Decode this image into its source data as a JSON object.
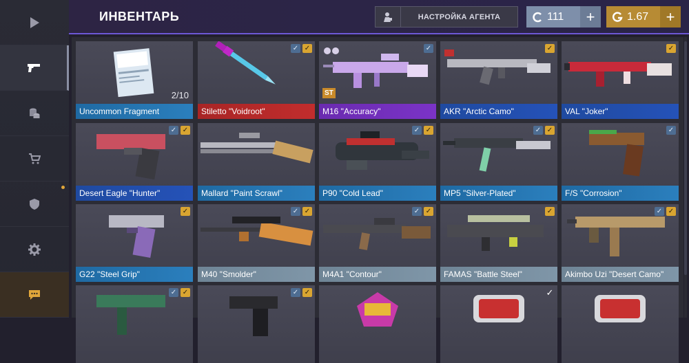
{
  "header": {
    "title": "ИНВЕНТАРЬ",
    "agent_button": "НАСТРОЙКА АГЕНТА",
    "silver_balance": "111",
    "gold_balance": "1.67",
    "add_symbol": "+"
  },
  "sidebar": {
    "items": [
      {
        "icon": "play-icon",
        "active": false
      },
      {
        "icon": "pistol-icon",
        "active": true
      },
      {
        "icon": "coins-icon",
        "active": false
      },
      {
        "icon": "cart-icon",
        "active": false
      },
      {
        "icon": "shield-icon",
        "active": false
      },
      {
        "icon": "gear-icon",
        "active": false
      },
      {
        "icon": "chat-icon",
        "active": false
      }
    ]
  },
  "inventory": {
    "items": [
      {
        "name": "Uncommon Fragment",
        "rarity": "uncommon",
        "count": "2/10"
      },
      {
        "name": "Stiletto \"Voidroot\"",
        "rarity": "legendary"
      },
      {
        "name": "M16 \"Accuracy\"",
        "rarity": "epic",
        "tag": "ST"
      },
      {
        "name": "AKR \"Arctic Camo\"",
        "rarity": "rare"
      },
      {
        "name": "VAL \"Joker\"",
        "rarity": "rare"
      },
      {
        "name": "Desert Eagle \"Hunter\"",
        "rarity": "rare"
      },
      {
        "name": "Mallard \"Paint Scrawl\"",
        "rarity": "uncommon"
      },
      {
        "name": "P90 \"Cold Lead\"",
        "rarity": "uncommon"
      },
      {
        "name": "MP5 \"Silver-Plated\"",
        "rarity": "uncommon"
      },
      {
        "name": "F/S \"Corrosion\"",
        "rarity": "uncommon"
      },
      {
        "name": "G22 \"Steel Grip\"",
        "rarity": "uncommon"
      },
      {
        "name": "M40 \"Smolder\"",
        "rarity": "common"
      },
      {
        "name": "M4A1 \"Contour\"",
        "rarity": "common"
      },
      {
        "name": "FAMAS \"Battle Steel\"",
        "rarity": "common"
      },
      {
        "name": "Akimbo Uzi \"Desert Camo\"",
        "rarity": "common"
      }
    ]
  },
  "colors": {
    "accent": "#6d58d6",
    "gold": "#b78b34",
    "silver": "#7e8faa"
  }
}
